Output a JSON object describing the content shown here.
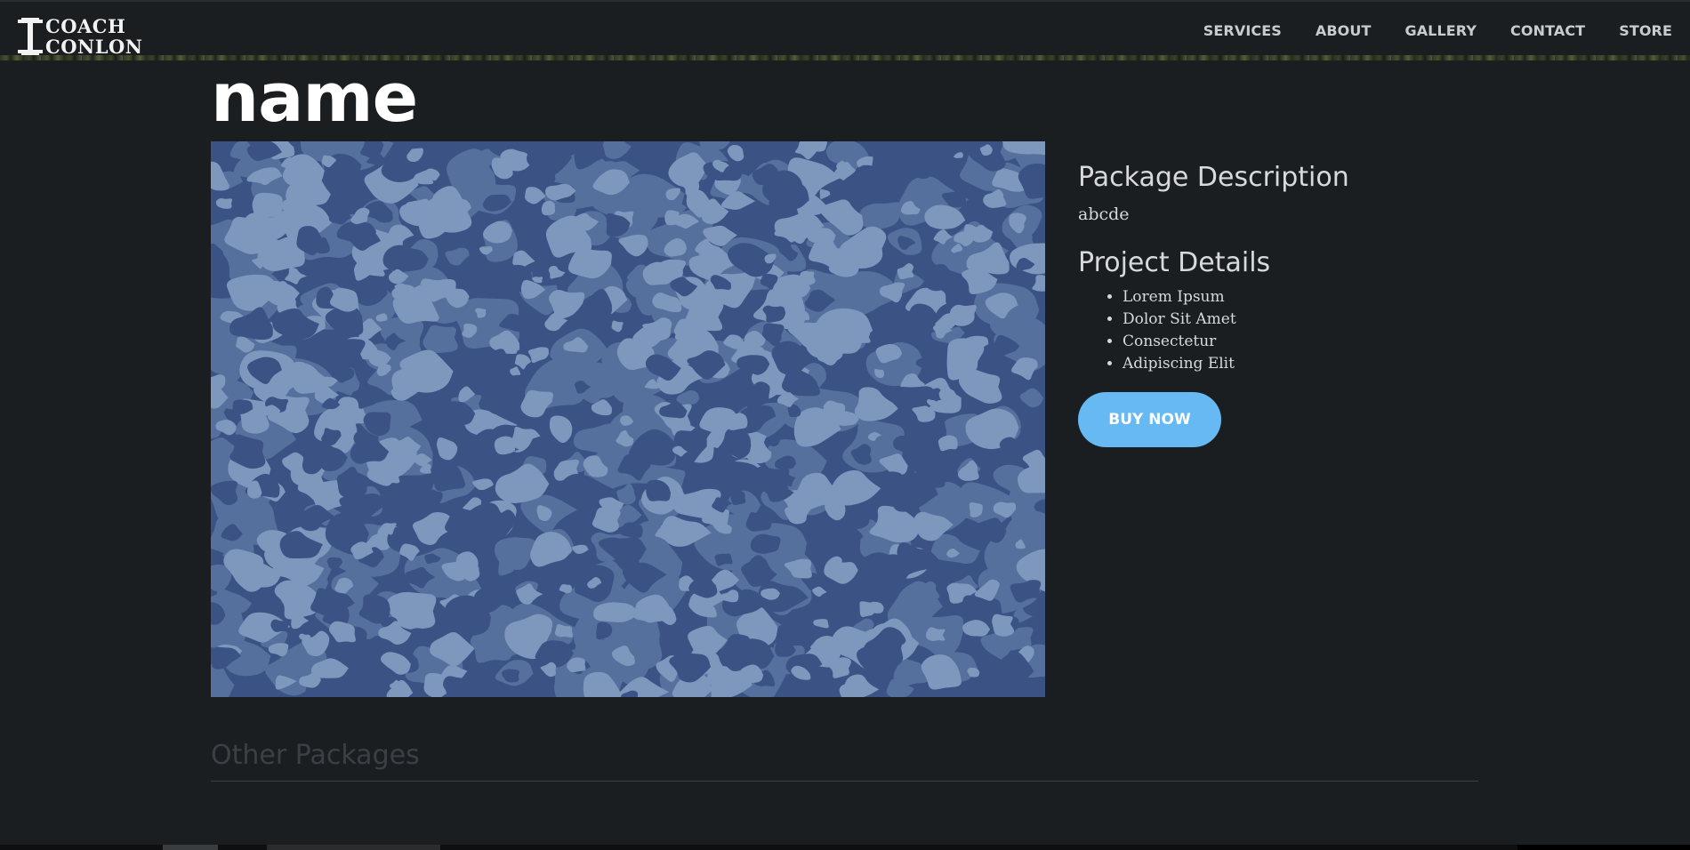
{
  "brand": {
    "line1": "COACH",
    "line2": "CONLON"
  },
  "nav": {
    "links": [
      {
        "label": "SERVICES"
      },
      {
        "label": "ABOUT"
      },
      {
        "label": "GALLERY"
      },
      {
        "label": "CONTACT"
      },
      {
        "label": "STORE"
      }
    ]
  },
  "product": {
    "title": "name",
    "image_icon": "blue-camo-image",
    "package_description_heading": "Package Description",
    "package_description": "abcde",
    "project_details_heading": "Project Details",
    "project_details": [
      "Lorem Ipsum",
      "Dolor Sit Amet",
      "Consectetur",
      "Adipiscing Elit"
    ],
    "buy_label": "BUY NOW"
  },
  "other_packages": {
    "heading": "Other Packages"
  },
  "colors": {
    "background": "#1b1e21",
    "accent_button": "#66b9f2",
    "camo_dark": "#3b5285",
    "camo_mid": "#56709e",
    "camo_light": "#7d97bd"
  }
}
